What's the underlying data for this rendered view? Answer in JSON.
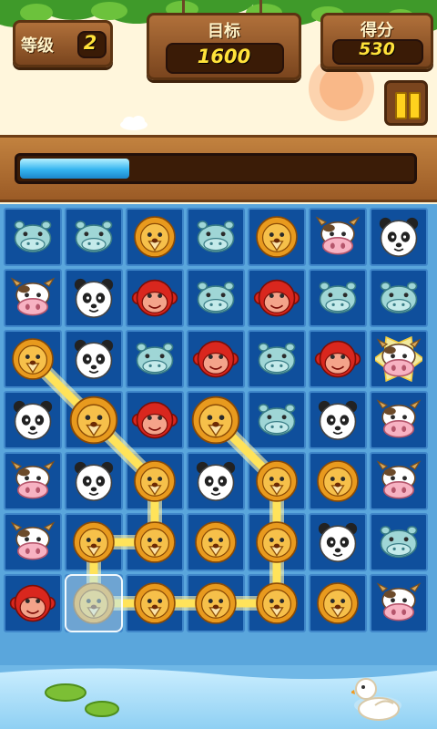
{
  "hud": {
    "level_label": "等级",
    "level_value": "2",
    "target_label": "目标",
    "target_value": "1600",
    "score_label": "得分",
    "score_value": "530"
  },
  "progress": {
    "fraction": 0.28
  },
  "pause_icon": "pause-icon",
  "board": {
    "columns": 7,
    "rows": 7,
    "grid": [
      [
        "hippo",
        "hippo",
        "lion",
        "hippo",
        "lion",
        "cow",
        "panda"
      ],
      [
        "cow",
        "panda",
        "monkey",
        "hippo",
        "monkey",
        "hippo",
        "hippo"
      ],
      [
        "lion",
        "panda",
        "hippo",
        "monkey",
        "hippo",
        "monkey",
        "cow"
      ],
      [
        "panda",
        "lion",
        "monkey",
        "lion",
        "hippo",
        "panda",
        "cow"
      ],
      [
        "cow",
        "panda",
        "lion",
        "panda",
        "lion",
        "lion",
        "cow"
      ],
      [
        "cow",
        "lion",
        "lion",
        "lion",
        "lion",
        "panda",
        "hippo"
      ],
      [
        "monkey",
        "lion",
        "lion",
        "lion",
        "lion",
        "lion",
        "cow"
      ]
    ],
    "selected_cells": [
      [
        6,
        1
      ]
    ],
    "highlighted_cells": [
      [
        2,
        6
      ]
    ],
    "enlarged_cells": [
      [
        3,
        1
      ],
      [
        3,
        3
      ]
    ],
    "connection_path": [
      [
        2,
        0
      ],
      [
        3,
        1
      ],
      [
        4,
        2
      ],
      [
        5,
        2
      ],
      [
        5,
        1
      ],
      [
        6,
        1
      ],
      [
        6,
        2
      ],
      [
        6,
        3
      ],
      [
        6,
        4
      ],
      [
        5,
        4
      ],
      [
        4,
        4
      ],
      [
        3,
        3
      ]
    ],
    "colors": {
      "cell": "#0f4f9c",
      "cell_border": "#3f86c9",
      "path": "#ffe35a",
      "path_glow": "#fff6b0"
    }
  }
}
